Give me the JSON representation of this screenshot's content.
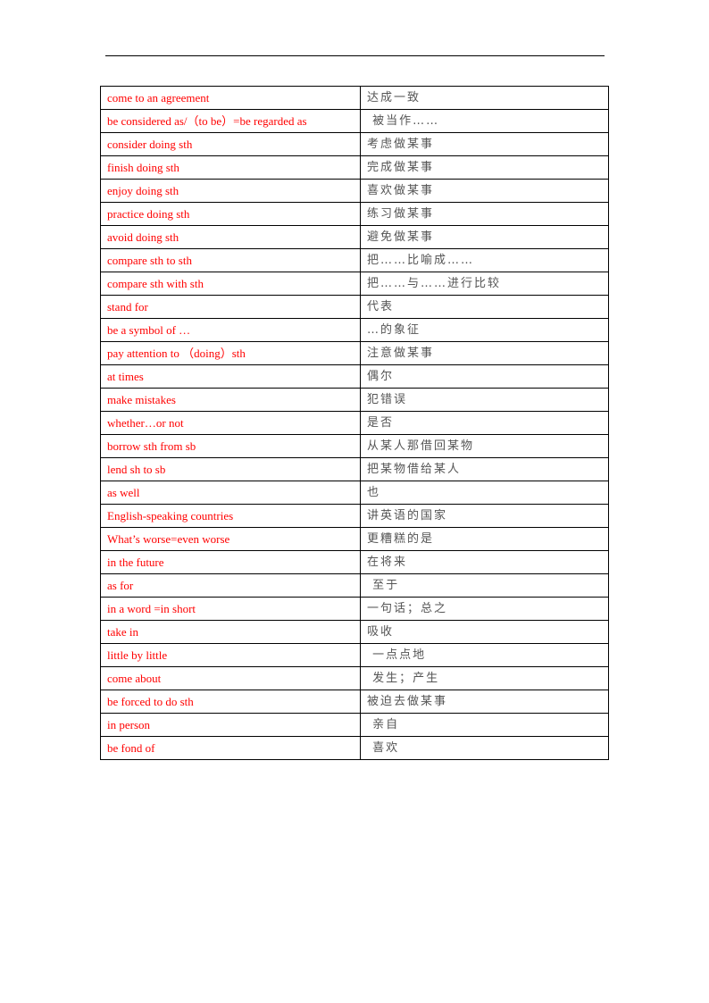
{
  "colors": {
    "english_text": "#ff0000",
    "chinese_text": "#555555",
    "border": "#000000"
  },
  "table": {
    "rows": [
      {
        "en": "come to an agreement",
        "zh": "达成一致"
      },
      {
        "en": "be considered as/（to be）=be regarded as",
        "zh": " 被当作……"
      },
      {
        "en": "consider doing sth",
        "zh": "考虑做某事"
      },
      {
        "en": "finish doing sth",
        "zh": "完成做某事"
      },
      {
        "en": "enjoy doing sth",
        "zh": "喜欢做某事"
      },
      {
        "en": "practice doing sth",
        "zh": "练习做某事"
      },
      {
        "en": "avoid doing sth",
        "zh": "避免做某事"
      },
      {
        "en": "compare sth to sth",
        "zh": "把……比喻成……"
      },
      {
        "en": "compare sth with sth",
        "zh": "把……与……进行比较"
      },
      {
        "en": "stand for",
        "zh": "代表"
      },
      {
        "en": "be a symbol of …",
        "zh": "…的象征"
      },
      {
        "en": "pay attention to （doing）sth",
        "zh": "注意做某事"
      },
      {
        "en": "at times",
        "zh": "偶尔"
      },
      {
        "en": "make mistakes",
        "zh": "犯错误"
      },
      {
        "en": "whether…or not",
        "zh": "是否"
      },
      {
        "en": "borrow sth from sb",
        "zh": "从某人那借回某物"
      },
      {
        "en": "lend sh to sb",
        "zh": "把某物借给某人"
      },
      {
        "en": "as well",
        "zh": "也"
      },
      {
        "en": "English-speaking countries",
        "zh": "讲英语的国家"
      },
      {
        "en": "What’s worse=even worse",
        "zh": "更糟糕的是"
      },
      {
        "en": "in the future",
        "zh": "在将来"
      },
      {
        "en": "as for",
        "zh": " 至于"
      },
      {
        "en": "in a word =in short",
        "zh": "一句话；总之"
      },
      {
        "en": "take in",
        "zh": "吸收"
      },
      {
        "en": "little by little",
        "zh": " 一点点地"
      },
      {
        "en": "come about",
        "zh": " 发生；产生"
      },
      {
        "en": "be forced to do sth",
        "zh": "被迫去做某事"
      },
      {
        "en": "in person",
        "zh": " 亲自"
      },
      {
        "en": "be fond of",
        "zh": " 喜欢"
      }
    ]
  }
}
